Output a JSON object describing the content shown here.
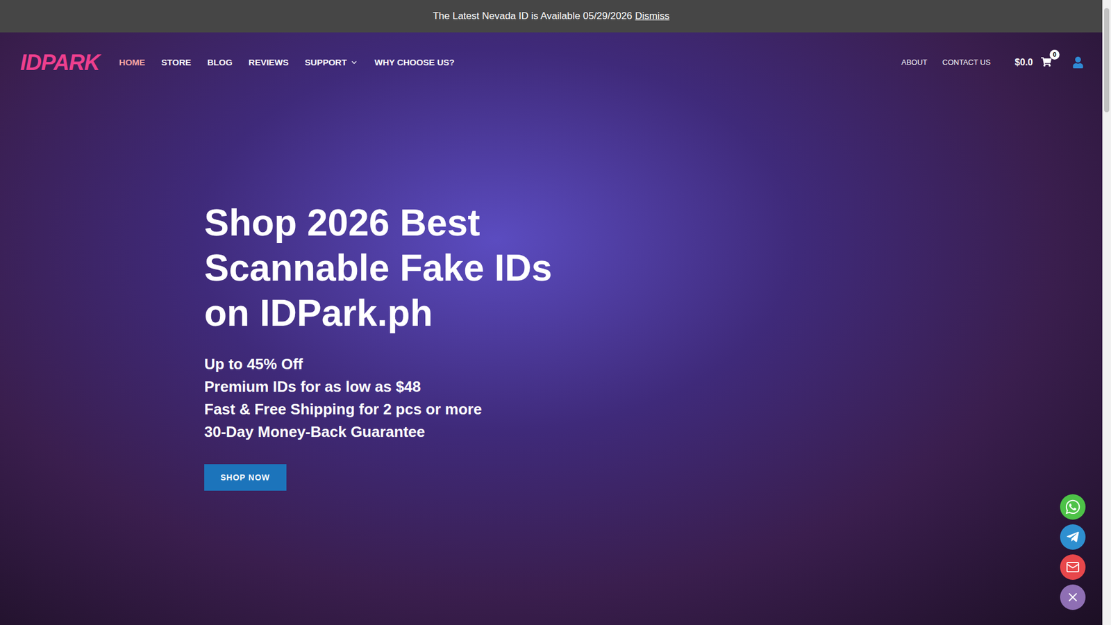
{
  "banner": {
    "text": "The Latest Nevada ID is Available 05/29/2026",
    "link": "Dismiss"
  },
  "logo": "IDPARK",
  "nav": [
    {
      "label": "HOME",
      "selected": true,
      "has_menu": false
    },
    {
      "label": "STORE",
      "selected": false,
      "has_menu": false
    },
    {
      "label": "BLOG",
      "selected": false,
      "has_menu": false
    },
    {
      "label": "REVIEWS",
      "selected": false,
      "has_menu": false
    },
    {
      "label": "SUPPORT",
      "selected": false,
      "has_menu": true
    },
    {
      "label": "WHY CHOOSE US?",
      "selected": false,
      "has_menu": false
    }
  ],
  "nav_right": [
    "ABOUT",
    "CONTACT US"
  ],
  "cart": {
    "total": "$0.0",
    "count": "0"
  },
  "hero": {
    "headline_lines": [
      "Shop 2026 Best",
      "Scannable Fake IDs",
      "on IDPark.ph"
    ],
    "features": [
      "Up to 45% Off",
      "Premium IDs for as low as $48",
      "Fast & Free Shipping for 2 pcs or more",
      "30-Day Money-Back Guarantee"
    ],
    "button": "SHOP NOW"
  },
  "contact_buttons": [
    {
      "kind": "whatsapp",
      "color": "#4dc247"
    },
    {
      "kind": "telegram",
      "color": "#2e8fd0"
    },
    {
      "kind": "email",
      "color": "#e8474b"
    },
    {
      "kind": "close",
      "color": "#8f6fb4"
    }
  ]
}
